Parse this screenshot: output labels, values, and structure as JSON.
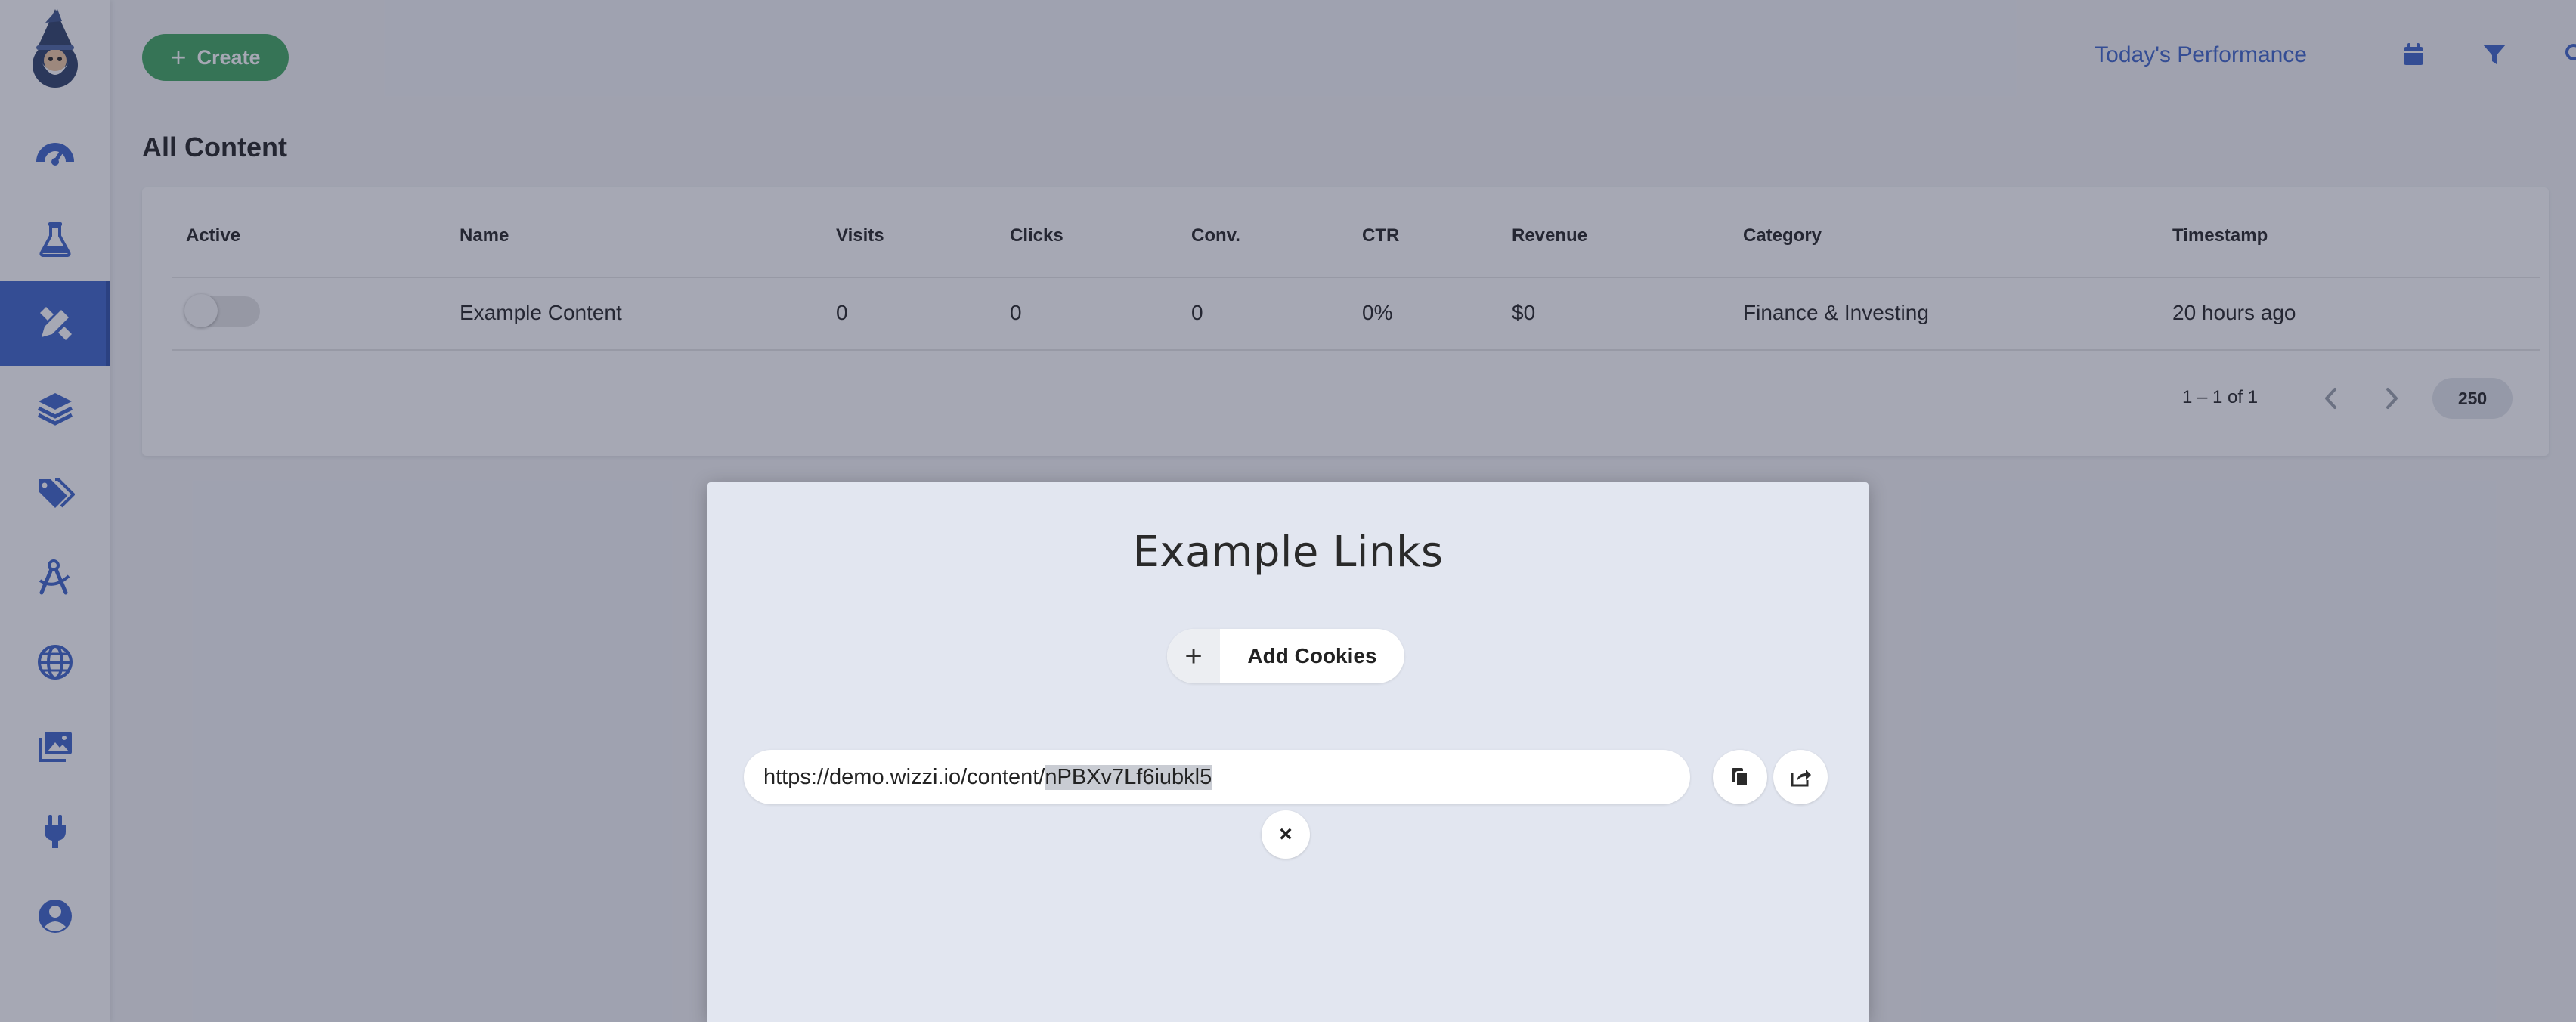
{
  "toolbar": {
    "create_label": "Create",
    "performance_label": "Today's Performance"
  },
  "page": {
    "title": "All Content"
  },
  "table": {
    "headers": [
      "Active",
      "Name",
      "Visits",
      "Clicks",
      "Conv.",
      "CTR",
      "Revenue",
      "Category",
      "Timestamp"
    ],
    "rows": [
      {
        "active": false,
        "name": "Example Content",
        "visits": "0",
        "clicks": "0",
        "conv": "0",
        "ctr": "0%",
        "revenue": "$0",
        "category": "Finance & Investing",
        "timestamp": "20 hours ago"
      }
    ],
    "pagination": {
      "range": "1 – 1 of 1",
      "per_page": "250"
    }
  },
  "modal": {
    "title": "Example Links",
    "add_cookies_label": "Add Cookies",
    "url_prefix": "https://demo.wizzi.io/content/",
    "url_selected": "nPBXv7Lf6iubkl5",
    "close_label": "×"
  },
  "colors": {
    "accent": "#3c63c9",
    "create_green": "#3fa55d",
    "overlay": "#2a304d"
  },
  "icons": {
    "sidebar": [
      "dashboard-gauge-icon",
      "flask-icon",
      "design-tools-icon",
      "layers-icon",
      "tags-icon",
      "drafting-compass-icon",
      "globe-icon",
      "images-icon",
      "plug-icon",
      "user-circle-icon"
    ],
    "top": [
      "calendar-icon",
      "filter-icon",
      "search-icon"
    ],
    "modal": [
      "copy-icon",
      "share-icon"
    ]
  }
}
